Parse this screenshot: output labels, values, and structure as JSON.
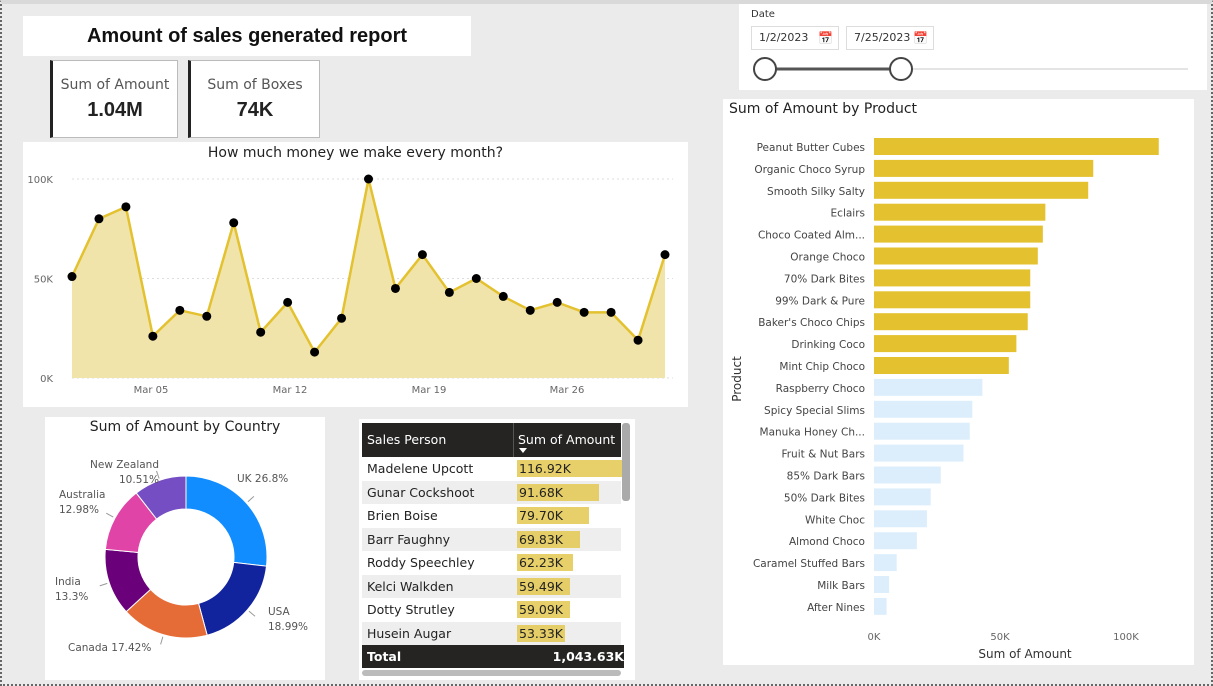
{
  "report": {
    "title": "Amount of sales generated report"
  },
  "kpis": {
    "amount_label": "Sum of Amount",
    "amount_value": "1.04M",
    "boxes_label": "Sum of Boxes",
    "boxes_value": "74K"
  },
  "date_filter": {
    "label": "Date",
    "start": "1/2/2023",
    "end": "7/25/2023",
    "calendar_icon": "calendar-icon"
  },
  "colors": {
    "gold": "#e3c12f",
    "area": "#f1e4ab",
    "light_bar": "#dceefc",
    "dark": "#252423"
  },
  "chart_data": [
    {
      "type": "line",
      "title": "How much money we make every month?",
      "x_ticks": [
        "Mar 05",
        "Mar 12",
        "Mar 19",
        "Mar 26"
      ],
      "y_ticks": [
        "0K",
        "50K",
        "100K"
      ],
      "ylim": [
        0,
        100000
      ],
      "grid": true,
      "series": [
        {
          "values": [
            51000,
            80000,
            86000,
            21000,
            34000,
            31000,
            78000,
            23000,
            38000,
            13000,
            30000,
            100000,
            45000,
            62000,
            43000,
            50000,
            41000,
            34000,
            38000,
            33000,
            33000,
            19000,
            62000
          ]
        }
      ]
    },
    {
      "type": "pie",
      "title": "Sum of Amount by Country",
      "slices": [
        {
          "label": "UK",
          "pct_label": "26.8%",
          "value": 26.8,
          "color": "#118dff"
        },
        {
          "label": "USA",
          "pct_label": "18.99%",
          "value": 18.99,
          "color": "#12239e"
        },
        {
          "label": "Canada",
          "pct_label": "17.42%",
          "value": 17.42,
          "color": "#e66c37"
        },
        {
          "label": "India",
          "pct_label": "13.3%",
          "value": 13.3,
          "color": "#6b007b"
        },
        {
          "label": "Australia",
          "pct_label": "12.98%",
          "value": 12.98,
          "color": "#e044a7"
        },
        {
          "label": "New Zealand",
          "pct_label": "10.51%",
          "value": 10.51,
          "color": "#744ec2"
        }
      ]
    },
    {
      "type": "bar",
      "title": "Sum of Amount by Product",
      "xlabel": "Sum of Amount",
      "ylabel": "Product",
      "x_ticks": [
        "0K",
        "50K",
        "100K"
      ],
      "xlim": [
        0,
        100000
      ],
      "categories": [
        "Peanut Butter Cubes",
        "Organic Choco Syrup",
        "Smooth Silky Salty",
        "Eclairs",
        "Choco Coated Alm...",
        "Orange Choco",
        "70% Dark Bites",
        "99% Dark & Pure",
        "Baker's Choco Chips",
        "Drinking Coco",
        "Mint Chip Choco",
        "Raspberry Choco",
        "Spicy Special Slims",
        "Manuka Honey Ch...",
        "Fruit & Nut Bars",
        "85% Dark Bars",
        "50% Dark Bites",
        "White Choc",
        "Almond Choco",
        "Caramel Stuffed Bars",
        "Milk Bars",
        "After Nines"
      ],
      "values": [
        113000,
        87000,
        85000,
        68000,
        67000,
        65000,
        62000,
        62000,
        61000,
        56500,
        53500,
        43000,
        39000,
        38000,
        35500,
        26500,
        22500,
        21000,
        17000,
        9000,
        6000,
        5000
      ],
      "highlighted_count": 11
    },
    {
      "type": "table",
      "columns": [
        "Sales Person",
        "Sum of Amount"
      ],
      "rows": [
        {
          "name": "Madelene Upcott",
          "amount_label": "116.92K",
          "value": 116920
        },
        {
          "name": "Gunar Cockshoot",
          "amount_label": "91.68K",
          "value": 91680
        },
        {
          "name": "Brien Boise",
          "amount_label": "79.70K",
          "value": 79700
        },
        {
          "name": "Barr Faughny",
          "amount_label": "69.83K",
          "value": 69830
        },
        {
          "name": "Roddy Speechley",
          "amount_label": "62.23K",
          "value": 62230
        },
        {
          "name": "Kelci Walkden",
          "amount_label": "59.49K",
          "value": 59490
        },
        {
          "name": "Dotty Strutley",
          "amount_label": "59.09K",
          "value": 59090
        },
        {
          "name": "Husein Augar",
          "amount_label": "53.33K",
          "value": 53330
        }
      ],
      "total_label": "Total",
      "total_value": "1,043.63K"
    }
  ]
}
